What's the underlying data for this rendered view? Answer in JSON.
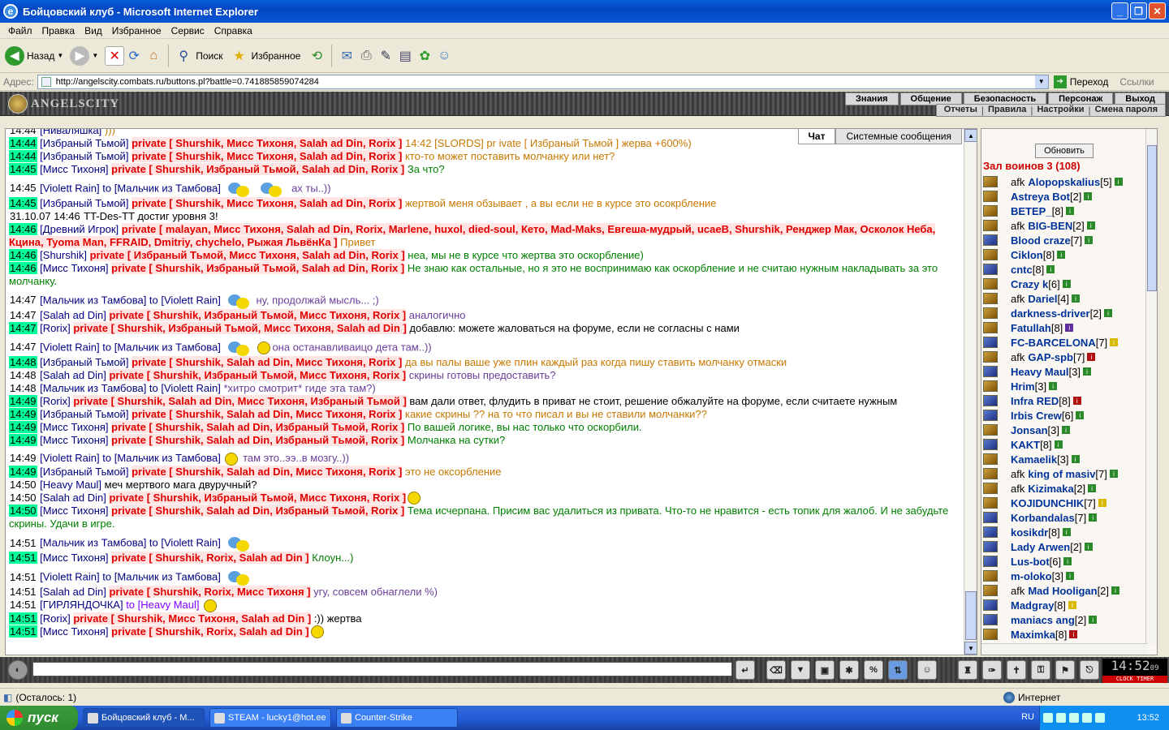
{
  "window": {
    "title": "Бойцовский клуб - Microsoft Internet Explorer"
  },
  "menu": [
    "Файл",
    "Правка",
    "Вид",
    "Избранное",
    "Сервис",
    "Справка"
  ],
  "toolbar": {
    "back": "Назад",
    "search": "Поиск",
    "favorites": "Избранное"
  },
  "address": {
    "label": "Адрес:",
    "url": "http://angelscity.combats.ru/buttons.pl?battle=0.741885859074284",
    "go": "Переход",
    "links": "Ссылки"
  },
  "site": {
    "logo": "ANGELSCITY",
    "nav_top": [
      "Знания",
      "Общение",
      "Безопасность",
      "Персонаж",
      "Выход"
    ],
    "nav_bottom": [
      "Отчеты",
      "Правила",
      "Настройки",
      "Смена пароля"
    ]
  },
  "chat": {
    "tabs": [
      "Чат",
      "Системные сообщения"
    ],
    "lines": [
      {
        "time": "14:44",
        "hl": false,
        "nick": "[Ниваляшка]",
        "rest": [
          {
            "c": "msgo",
            "t": " )))"
          }
        ]
      },
      {
        "time": "14:44",
        "hl": true,
        "nick": "[Избраный Тьмой]",
        "priv": "private [ Shurshik, Мисс Тихоня, Salah ad Din, Rorix ]",
        "rest": [
          {
            "c": "msgo",
            "t": " 14:42 [SLORDS] pr ivate [ Избраный Тьмой ] жерва +600%)"
          }
        ]
      },
      {
        "time": "14:44",
        "hl": true,
        "nick": "[Избраный Тьмой]",
        "priv": "private [ Shurshik, Мисс Тихоня, Salah ad Din, Rorix ]",
        "rest": [
          {
            "c": "msgo",
            "t": " кто-то может поставить молчанку или нет?"
          }
        ]
      },
      {
        "time": "14:45",
        "hl": true,
        "nick": "[Мисс Тихоня]",
        "priv": "private [ Shurshik, Избраный Тьмой, Salah ad Din, Rorix ]",
        "rest": [
          {
            "c": "msg",
            "t": " За что?"
          }
        ]
      },
      {
        "time": "14:45",
        "hl": false,
        "gap": true,
        "nick": "[Violett Rain]",
        "to": " to [Мальчик из Тамбова] ",
        "fly": 2,
        "rest": [
          {
            "c": "msgp",
            "t": " ах ты..))"
          }
        ]
      },
      {
        "time": "14:45",
        "hl": true,
        "nick": "[Избраный Тьмой]",
        "priv": "private [ Shurshik, Мисс Тихоня, Salah ad Din, Rorix ]",
        "rest": [
          {
            "c": "msgo",
            "t": " жертвой меня обзывает , а вы если не в курсе это осокрбление"
          }
        ]
      },
      {
        "time": "31.10.07 14:46",
        "hl": false,
        "sys": true,
        "rest": [
          {
            "c": "msgb",
            "t": " TT-Des-TT достиг уровня 3!"
          }
        ]
      },
      {
        "time": "14:46",
        "hl": true,
        "nick": "[Древний Игрок]",
        "priv": "private [ malayan, Мисс Тихоня, Salah ad Din, Rorix, Marlene, huxol, died-soul, Кето, Mad-Maks, Евгеша-мудрый, ucaeB, Shurshik, Ренджер Мак, Осколок Неба, Кцина, Tyoma Man, FFRAID, Dmitriy, chychelo, Рыжая ЛьвёнКа ]",
        "rest": [
          {
            "c": "msgo",
            "t": " Привет"
          }
        ]
      },
      {
        "time": "14:46",
        "hl": true,
        "nick": "[Shurshik]",
        "priv": "private [ Избраный Тьмой, Мисс Тихоня, Salah ad Din, Rorix ]",
        "rest": [
          {
            "c": "msg",
            "t": " нea, мы не в курсе что жертва это оскорбление)"
          }
        ]
      },
      {
        "time": "14:46",
        "hl": true,
        "nick": "[Мисс Тихоня]",
        "priv": "private [ Shurshik, Избраный Тьмой, Salah ad Din, Rorix ]",
        "rest": [
          {
            "c": "msg",
            "t": " Не знаю как остальные, но я это не воспринимаю как оскорбление и не считаю нужным накладывать за это молчанку."
          }
        ]
      },
      {
        "time": "14:47",
        "hl": false,
        "gap": true,
        "nick": "[Мальчик из Тамбова]",
        "to": " to [Violett Rain] ",
        "rest": [
          {
            "c": "msgp",
            "t": "ну, продолжай мысль... ;)"
          }
        ],
        "fly": 1
      },
      {
        "time": "14:47",
        "hl": false,
        "nick": "[Salah ad Din]",
        "priv": "private [ Shurshik, Избраный Тьмой, Мисс Тихоня, Rorix ]",
        "rest": [
          {
            "c": "msgp",
            "t": " аналогично"
          }
        ]
      },
      {
        "time": "14:47",
        "hl": true,
        "nick": "[Rorix]",
        "priv": "private [ Shurshik, Избраный Тьмой, Мисс Тихоня, Salah ad Din ]",
        "rest": [
          {
            "c": "msgb",
            "t": " добавлю: можете жаловаться на форуме, если не согласны с нами"
          }
        ]
      },
      {
        "time": "14:47",
        "hl": false,
        "gap": true,
        "nick": "[Violett Rain]",
        "to": " to [Мальчик из Тамбова] ",
        "rest": [
          {
            "c": "msgp",
            "t": "она останавливаицо дета там..))"
          }
        ],
        "smile": 1,
        "fly": 1
      },
      {
        "time": "14:48",
        "hl": true,
        "nick": "[Избраный Тьмой]",
        "priv": "private [ Shurshik, Salah ad Din, Мисс Тихоня, Rorix ]",
        "rest": [
          {
            "c": "msgo",
            "t": " да вы палы ваше уже плин каждый раз когда пишу ставить молчанку отмаски"
          }
        ]
      },
      {
        "time": "14:48",
        "hl": false,
        "nick": "[Salah ad Din]",
        "priv": "private [ Shurshik, Избраный Тьмой, Мисс Тихоня, Rorix ]",
        "rest": [
          {
            "c": "msgp",
            "t": " скрины готовы предоставить?"
          }
        ]
      },
      {
        "time": "14:48",
        "hl": false,
        "nick": "[Мальчик из Тамбова]",
        "to": " to [Violett Rain] ",
        "rest": [
          {
            "c": "msgp",
            "t": "*хитро смотрит* гиде эта там?)"
          }
        ]
      },
      {
        "time": "14:49",
        "hl": true,
        "nick": "[Rorix]",
        "priv": "private [ Shurshik, Salah ad Din, Мисс Тихоня, Избраный Тьмой ]",
        "rest": [
          {
            "c": "msgb",
            "t": " вам дали ответ, флудить в приват не стоит, решение обжалуйте на форуме, если считаете нужным"
          }
        ]
      },
      {
        "time": "14:49",
        "hl": true,
        "nick": "[Избраный Тьмой]",
        "priv": "private [ Shurshik, Salah ad Din, Мисс Тихоня, Rorix ]",
        "rest": [
          {
            "c": "msgo",
            "t": " какие скрины ?? на то что писал и вы не ставили молчанки??"
          }
        ]
      },
      {
        "time": "14:49",
        "hl": true,
        "nick": "[Мисс Тихоня]",
        "priv": "private [ Shurshik, Salah ad Din, Избраный Тьмой, Rorix ]",
        "rest": [
          {
            "c": "msg",
            "t": " По вашей логике, вы нас только что оскорбили."
          }
        ]
      },
      {
        "time": "14:49",
        "hl": true,
        "nick": "[Мисс Тихоня]",
        "priv": "private [ Shurshik, Salah ad Din, Избраный Тьмой, Rorix ]",
        "rest": [
          {
            "c": "msg",
            "t": " Молчанка на сутки?"
          }
        ]
      },
      {
        "time": "14:49",
        "hl": false,
        "gap": true,
        "nick": "[Violett Rain]",
        "to": " to [Мальчик из Тамбова] ",
        "smile": 1,
        "rest": [
          {
            "c": "msgp",
            "t": " там это..ээ..в мозгу..))"
          }
        ]
      },
      {
        "time": "14:49",
        "hl": true,
        "nick": "[Избраный Тьмой]",
        "priv": "private [ Shurshik, Salah ad Din, Мисс Тихоня, Rorix ]",
        "rest": [
          {
            "c": "msgo",
            "t": " это не оксорбление"
          }
        ]
      },
      {
        "time": "14:50",
        "hl": false,
        "nick": "[Heavy Maul]",
        "rest": [
          {
            "c": "msgb",
            "t": " меч мертвого мага двуручный?"
          }
        ]
      },
      {
        "time": "14:50",
        "hl": false,
        "nick": "[Salah ad Din]",
        "priv": "private [ Shurshik, Избраный Тьмой, Мисс Тихоня, Rorix ]",
        "smile": 1,
        "rest": []
      },
      {
        "time": "14:50",
        "hl": true,
        "nick": "[Мисс Тихоня]",
        "priv": "private [ Shurshik, Salah ad Din, Избраный Тьмой, Rorix ]",
        "rest": [
          {
            "c": "msg",
            "t": " Тема исчерпана. Присим вас удалиться из привата. Что-то не нравится - есть топик для жалоб. И не забудьте скрины. Удачи в игре."
          }
        ]
      },
      {
        "time": "14:51",
        "hl": false,
        "gap": true,
        "nick": "[Мальчик из Тамбова]",
        "to": " to [Violett Rain] ",
        "fly": 1,
        "rest": []
      },
      {
        "time": "14:51",
        "hl": true,
        "nick": "[Мисс Тихоня]",
        "priv": "private [ Shurshik, Rorix, Salah ad Din ]",
        "rest": [
          {
            "c": "msg",
            "t": " Клоун...)"
          }
        ]
      },
      {
        "time": "14:51",
        "hl": false,
        "gap": true,
        "nick": "[Violett Rain]",
        "to": " to [Мальчик из Тамбова] ",
        "fly": 1,
        "rest": []
      },
      {
        "time": "14:51",
        "hl": false,
        "nick": "[Salah ad Din]",
        "priv": "private [ Shurshik, Rorix, Мисс Тихоня ]",
        "rest": [
          {
            "c": "msgp",
            "t": " угу, совсем обнаглели %)"
          }
        ]
      },
      {
        "time": "14:51",
        "hl": false,
        "nick": "[ГИРЛЯНДОЧКА]",
        "to": " to [Heavy Maul] ",
        "toClass": "msgv",
        "smile": 1,
        "rest": []
      },
      {
        "time": "14:51",
        "hl": true,
        "nick": "[Rorix]",
        "priv": "private [ Shurshik, Мисс Тихоня, Salah ad Din ]",
        "rest": [
          {
            "c": "msgb",
            "t": " :)) жертва"
          }
        ]
      },
      {
        "time": "14:51",
        "hl": true,
        "nick": "[Мисс Тихоня]",
        "priv": "private [ Shurshik, Rorix, Salah ad Din ]",
        "smile": 1,
        "rest": []
      }
    ]
  },
  "sidebar": {
    "refresh": "Обновить",
    "room": "Зал воинов 3 (108)",
    "users": [
      {
        "afk": "afk",
        "name": "Alopopskalius",
        "level": "[5]",
        "inf": "g",
        "blue": false
      },
      {
        "name": "Astreya Bot",
        "level": "[2]",
        "inf": "g",
        "blue": false
      },
      {
        "name": "ВЕТЕР_",
        "level": "[8]",
        "inf": "g",
        "blue": false
      },
      {
        "afk": "afk",
        "name": "BIG-BEN",
        "level": "[2]",
        "inf": "g",
        "blue": false
      },
      {
        "name": "Blood craze",
        "level": "[7]",
        "inf": "g",
        "blue": true
      },
      {
        "name": "Ciklon",
        "level": "[8]",
        "inf": "g",
        "blue": false
      },
      {
        "name": "cntc",
        "level": "[8]",
        "inf": "g",
        "blue": true
      },
      {
        "name": "Crazy k",
        "level": "[6]",
        "inf": "g",
        "blue": false
      },
      {
        "afk": "afk",
        "name": "Dariel",
        "level": "[4]",
        "inf": "g",
        "blue": false
      },
      {
        "name": "darkness-driver",
        "level": "[2]",
        "inf": "g",
        "blue": false
      },
      {
        "name": "Fatullah",
        "level": "[8]",
        "inf": "p",
        "blue": false
      },
      {
        "name": "FC-BARCELONA",
        "level": "[7]",
        "inf": "y",
        "blue": true
      },
      {
        "afk": "afk",
        "name": "GAP-spb",
        "level": "[7]",
        "inf": "r",
        "blue": false
      },
      {
        "name": "Heavy Maul",
        "level": "[3]",
        "inf": "g",
        "blue": true
      },
      {
        "name": "Hrim",
        "level": "[3]",
        "inf": "g",
        "blue": false
      },
      {
        "name": "Infra RED",
        "level": "[8]",
        "inf": "r",
        "blue": true
      },
      {
        "name": "Irbis Crew",
        "level": "[6]",
        "inf": "g",
        "blue": true
      },
      {
        "name": "Jonsan",
        "level": "[3]",
        "inf": "g",
        "blue": false
      },
      {
        "name": "KAKT",
        "level": "[8]",
        "inf": "g",
        "blue": true
      },
      {
        "name": "Kamaelik",
        "level": "[3]",
        "inf": "g",
        "blue": false
      },
      {
        "afk": "afk",
        "name": "king of masiv",
        "level": "[7]",
        "inf": "g",
        "blue": false
      },
      {
        "afk": "afk",
        "name": "Kizimaka",
        "level": "[2]",
        "inf": "g",
        "blue": false
      },
      {
        "name": "KOJIDUNCHIK",
        "level": "[7]",
        "inf": "y",
        "blue": false
      },
      {
        "name": "Korbandalas",
        "level": "[7]",
        "inf": "g",
        "blue": true
      },
      {
        "name": "kosikdr",
        "level": "[8]",
        "inf": "g",
        "blue": true
      },
      {
        "name": "Lady Arwen",
        "level": "[2]",
        "inf": "g",
        "blue": true
      },
      {
        "name": "Lus-bot",
        "level": "[6]",
        "inf": "g",
        "blue": true
      },
      {
        "name": "m-oloko",
        "level": "[3]",
        "inf": "g",
        "blue": false
      },
      {
        "afk": "afk",
        "name": "Mad Hooligan",
        "level": "[2]",
        "inf": "g",
        "blue": false
      },
      {
        "name": "Madgray",
        "level": "[8]",
        "inf": "y",
        "blue": true
      },
      {
        "name": "maniacs ang",
        "level": "[2]",
        "inf": "g",
        "blue": true
      },
      {
        "name": "Maximka",
        "level": "[8]",
        "inf": "r",
        "blue": false
      }
    ]
  },
  "bottombar": {
    "clock": "14:52",
    "clock_sec": "09",
    "clock_label": "CLOCK TIMER"
  },
  "status": {
    "text": "(Осталось: 1)",
    "zone": "Интернет"
  },
  "taskbar": {
    "start": "пуск",
    "tasks": [
      "Бойцовский клуб - М...",
      "STEAM - lucky1@hot.ee",
      "Counter-Strike"
    ],
    "lang": "RU",
    "time": "13:52"
  }
}
